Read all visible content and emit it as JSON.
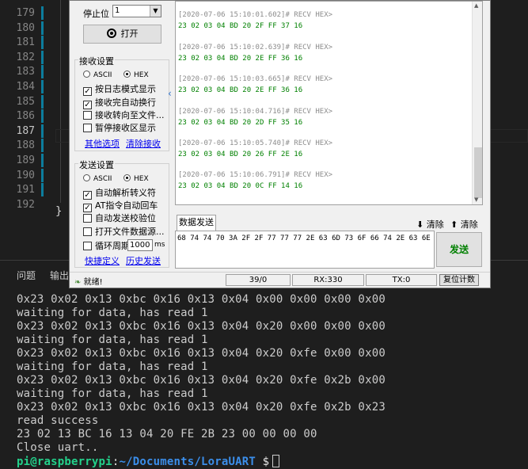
{
  "editor": {
    "line_numbers": [
      "179",
      "180",
      "181",
      "182",
      "183",
      "184",
      "185",
      "186",
      "187",
      "188",
      "189",
      "190",
      "191",
      "192"
    ],
    "closing_brace": "}"
  },
  "panel": {
    "tab_problems": "问题",
    "tab_output": "输出"
  },
  "terminal": {
    "lines": [
      "0x23 0x02 0x13 0xbc 0x16 0x13 0x04 0x00 0x00 0x00 0x00",
      "waiting for data, has read 1",
      "0x23 0x02 0x13 0xbc 0x16 0x13 0x04 0x20 0x00 0x00 0x00",
      "waiting for data, has read 1",
      "0x23 0x02 0x13 0xbc 0x16 0x13 0x04 0x20 0xfe 0x00 0x00",
      "waiting for data, has read 1",
      "0x23 0x02 0x13 0xbc 0x16 0x13 0x04 0x20 0xfe 0x2b 0x00",
      "waiting for data, has read 1",
      "0x23 0x02 0x13 0xbc 0x16 0x13 0x04 0x20 0xfe 0x2b 0x23",
      "read success",
      "23 02 13 BC 16 13 04 20 FE 2B 23 00 00 00 00",
      "Close uart.."
    ],
    "prompt_user": "pi@raspberrypi",
    "prompt_sep": ":",
    "prompt_path": "~/Documents/LoraUART",
    "prompt_symbol": "$"
  },
  "serial_tool": {
    "stop_bit_label": "停止位",
    "stop_bit_value": "1",
    "open_button": "打开",
    "receive_settings": {
      "title": "接收设置",
      "ascii": "ASCII",
      "hex": "HEX",
      "opt_log_mode": "按日志模式显示",
      "opt_auto_newline": "接收完自动换行",
      "opt_to_file": "接收转向至文件...",
      "opt_pause": "暂停接收区显示",
      "link_more": "其他选项",
      "link_clear": "清除接收"
    },
    "send_settings": {
      "title": "发送设置",
      "ascii": "ASCII",
      "hex": "HEX",
      "opt_auto_escape": "自动解析转义符",
      "opt_at_return": "AT指令自动回车",
      "opt_checksum": "自动发送校验位",
      "opt_file_source": "打开文件数据源...",
      "opt_cycle": "循环周期",
      "cycle_value": "1000",
      "cycle_unit": "ms",
      "link_shortcut": "快捷定义",
      "link_history": "历史发送"
    },
    "receive_log": [
      {
        "ts": "[2020-07-06 15:10:01.602]# RECV HEX>",
        "data": "23 02 03 04 BD 20 2F FF 37 16"
      },
      {
        "ts": "[2020-07-06 15:10:02.639]# RECV HEX>",
        "data": "23 02 03 04 BD 20 2E FF 36 16"
      },
      {
        "ts": "[2020-07-06 15:10:03.665]# RECV HEX>",
        "data": "23 02 03 04 BD 20 2E FF 36 16"
      },
      {
        "ts": "[2020-07-06 15:10:04.716]# RECV HEX>",
        "data": "23 02 03 04 BD 20 2D FF 35 16"
      },
      {
        "ts": "[2020-07-06 15:10:05.740]# RECV HEX>",
        "data": "23 02 03 04 BD 20 26 FF 2E 16"
      },
      {
        "ts": "[2020-07-06 15:10:06.791]# RECV HEX>",
        "data": "23 02 03 04 BD 20 0C FF 14 16"
      }
    ],
    "send_tab": "数据发送",
    "clear_send": "清除",
    "clear_all": "清除",
    "send_text": "68 74 74 70 3A 2F 2F 77 77 77 2E 63 6D 73 6F 66 74 2E 63 6E",
    "send_button": "发送",
    "status": {
      "ready": "就绪!",
      "count": "39/0",
      "rx": "RX:330",
      "tx": "TX:0",
      "reset": "复位计数"
    }
  }
}
